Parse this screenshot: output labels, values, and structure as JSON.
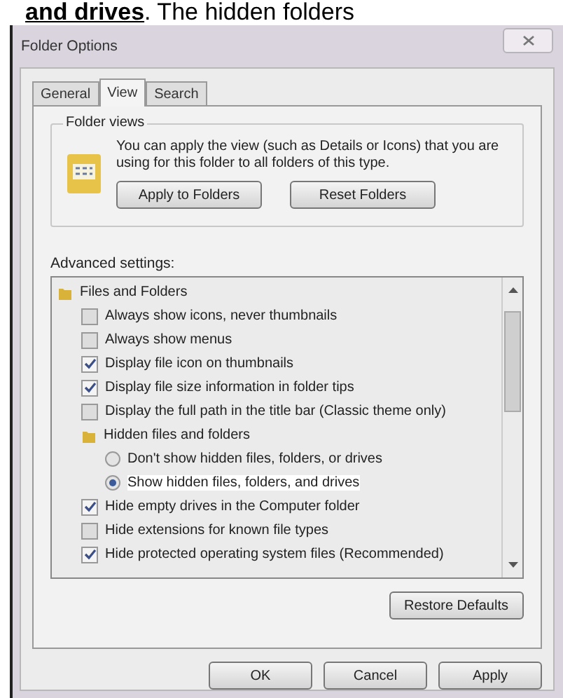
{
  "heading": "**and drives**. The hidden folders",
  "window": {
    "title": "Folder Options"
  },
  "tabs": [
    {
      "label": "General",
      "selected": false
    },
    {
      "label": "View",
      "selected": true
    },
    {
      "label": "Search",
      "selected": false
    }
  ],
  "folder_views": {
    "label": "Folder views",
    "description": "You can apply the view (such as Details or Icons) that you are using for this folder to all folders of this type.",
    "buttons": [
      "Apply to Folders",
      "Reset Folders"
    ]
  },
  "advanced_settings": {
    "label": "Advanced settings:",
    "items": [
      {
        "kind": "group",
        "label": "Files and Folders",
        "children": [
          {
            "kind": "checkbox",
            "label": "Always show icons, never thumbnails",
            "checked": false
          },
          {
            "kind": "checkbox",
            "label": "Always show menus",
            "checked": false
          },
          {
            "kind": "checkbox",
            "label": "Display file icon on thumbnails",
            "checked": true
          },
          {
            "kind": "checkbox",
            "label": "Display file size information in folder tips",
            "checked": true
          },
          {
            "kind": "checkbox",
            "label": "Display the full path in the title bar (Classic theme only)",
            "checked": false
          },
          {
            "kind": "group",
            "label": "Hidden files and folders",
            "children": [
              {
                "kind": "radio",
                "label": "Don't show hidden files, folders, or drives",
                "selected": false
              },
              {
                "kind": "radio",
                "label": "Show hidden files, folders, and drives",
                "selected": true
              }
            ]
          },
          {
            "kind": "checkbox",
            "label": "Hide empty drives in the Computer folder",
            "checked": true
          },
          {
            "kind": "checkbox",
            "label": "Hide extensions for known file types",
            "checked": false
          },
          {
            "kind": "checkbox",
            "label": "Hide protected operating system files (Recommended)",
            "checked": true
          }
        ]
      }
    ]
  },
  "restore_button": "Restore Defaults",
  "dialog_buttons": [
    "OK",
    "Cancel",
    "Apply"
  ]
}
